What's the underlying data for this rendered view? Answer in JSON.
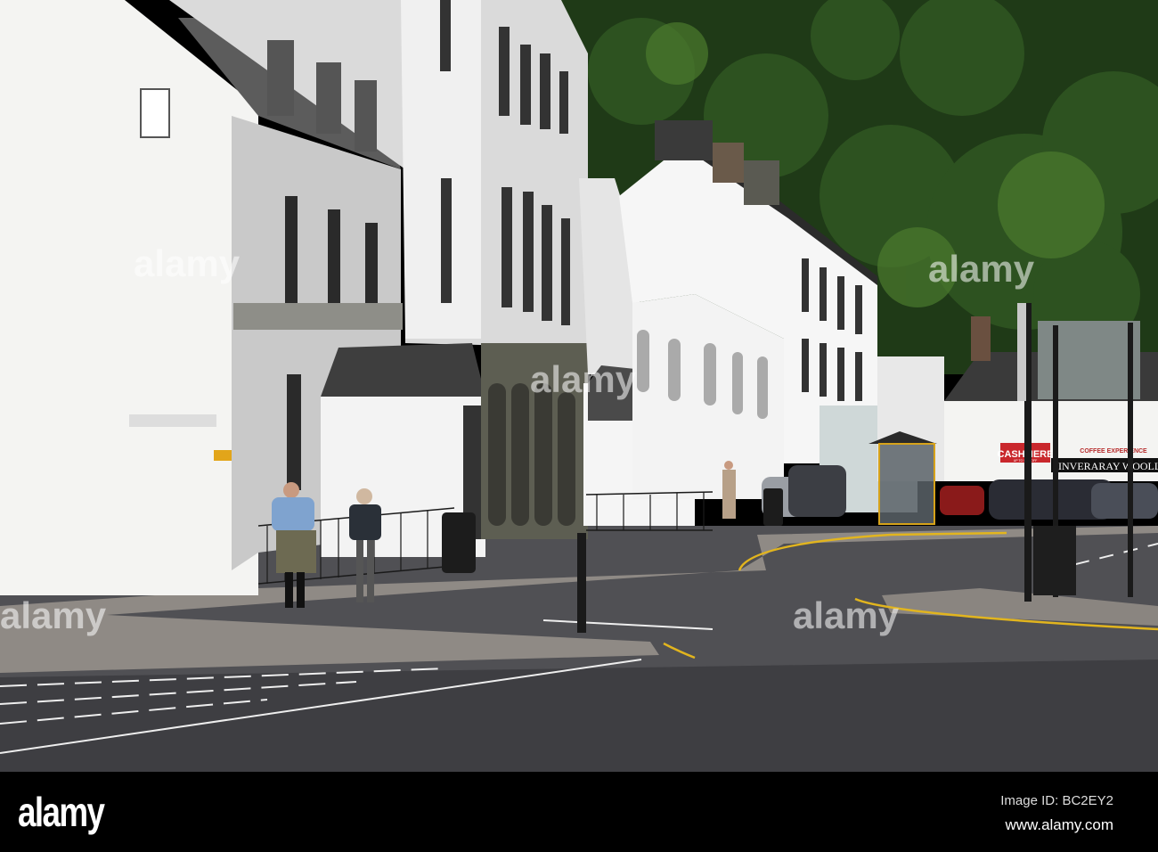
{
  "photo": {
    "shop_signs": {
      "sale_banner": "CASHMERE",
      "sale_banner_sub": "UP TO 50% OFF",
      "coffee": "COFFEE EXPERIENCE",
      "woollen_mill": "INVERARAY WOOLLEN"
    },
    "watermark": "alamy"
  },
  "footer": {
    "logo": "alamy",
    "image_id": "Image ID: BC2EY2",
    "url": "www.alamy.com"
  },
  "colors": {
    "footer_bg": "#000000",
    "forest": "#1f3a17",
    "road": "#4a4a4e",
    "wall": "#f2f2f0"
  }
}
